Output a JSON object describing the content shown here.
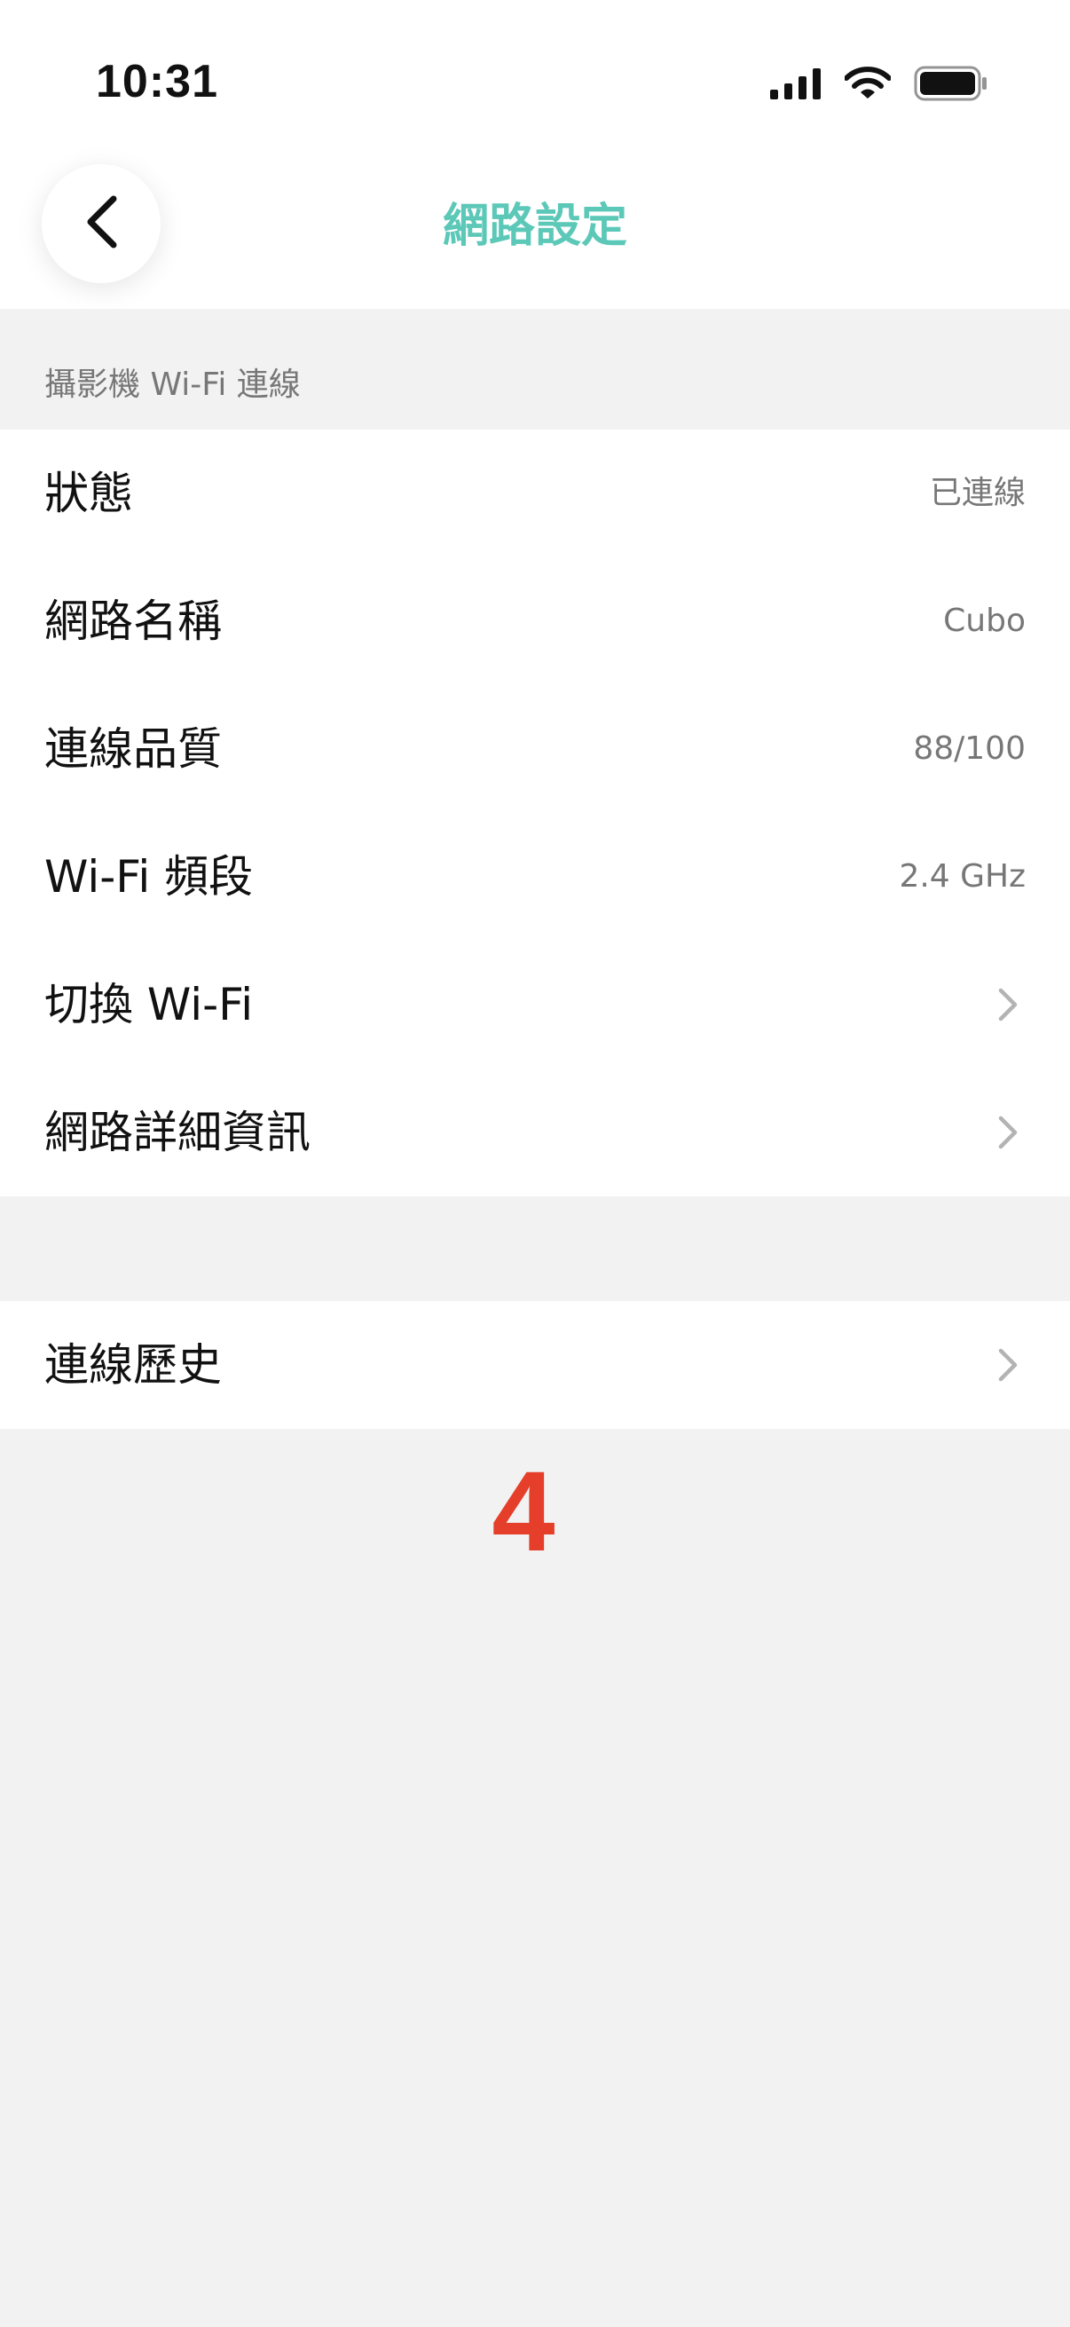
{
  "status_bar": {
    "time": "10:31",
    "icons": [
      "cellular-signal-icon",
      "wifi-icon",
      "battery-icon"
    ]
  },
  "nav": {
    "back_icon": "chevron-left-icon",
    "title": "網路設定"
  },
  "section": {
    "header": "攝影機 Wi-Fi 連線"
  },
  "rows": [
    {
      "label": "狀態",
      "value": "已連線"
    },
    {
      "label": "網路名稱",
      "value": "Cubo"
    },
    {
      "label": "連線品質",
      "value": "88/100"
    },
    {
      "label": "Wi-Fi 頻段",
      "value": "2.4 GHz"
    },
    {
      "label": "切換 Wi-Fi",
      "icon": "chevron-right-icon"
    },
    {
      "label": "網路詳細資訊",
      "icon": "chevron-right-icon"
    }
  ],
  "history_row": {
    "label": "連線歷史",
    "icon": "chevron-right-icon"
  },
  "step_marker": "4",
  "colors": {
    "accent": "#5cc8b8",
    "marker": "#e53e2b",
    "background": "#f2f2f2",
    "secondary_text": "#777777"
  }
}
